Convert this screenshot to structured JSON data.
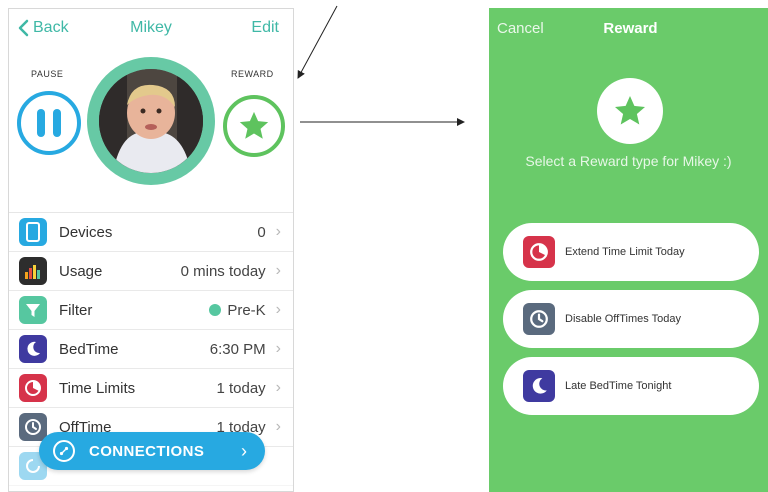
{
  "left_screen": {
    "nav": {
      "back_label": "Back",
      "title": "Mikey",
      "edit_label": "Edit"
    },
    "pause_label": "PAUSE",
    "reward_label": "REWARD",
    "rows": [
      {
        "name": "devices",
        "label": "Devices",
        "value": "0",
        "icon": "tablet-icon",
        "color": "#27a9e1"
      },
      {
        "name": "usage",
        "label": "Usage",
        "value": "0 mins today",
        "icon": "bar-chart-icon",
        "color": "#2d2d2d"
      },
      {
        "name": "filter",
        "label": "Filter",
        "value": "Pre-K",
        "icon": "funnel-icon",
        "color": "#56c7a0"
      },
      {
        "name": "bedtime",
        "label": "BedTime",
        "value": "6:30 PM",
        "icon": "moon-icon",
        "color": "#3f3aa0"
      },
      {
        "name": "time-limits",
        "label": "Time Limits",
        "value": "1 today",
        "icon": "timer-icon",
        "color": "#d6334a"
      },
      {
        "name": "offtime",
        "label": "OffTime",
        "value": "1 today",
        "icon": "clock-icon",
        "color": "#5a6a7e"
      }
    ],
    "connections_label": "CONNECTIONS"
  },
  "right_screen": {
    "cancel_label": "Cancel",
    "title": "Reward",
    "prompt": "Select a Reward type for Mikey :)",
    "options": [
      {
        "label": "Extend Time Limit Today",
        "icon": "timer-icon",
        "color": "#d6334a"
      },
      {
        "label": "Disable OffTimes Today",
        "icon": "clock-icon",
        "color": "#5a6a7e"
      },
      {
        "label": "Late BedTime Tonight",
        "icon": "moon-icon",
        "color": "#3f3aa0"
      }
    ]
  },
  "colors": {
    "accent_teal": "#3fb8a6",
    "accent_blue": "#27a9e1",
    "reward_green": "#6acb6a"
  }
}
